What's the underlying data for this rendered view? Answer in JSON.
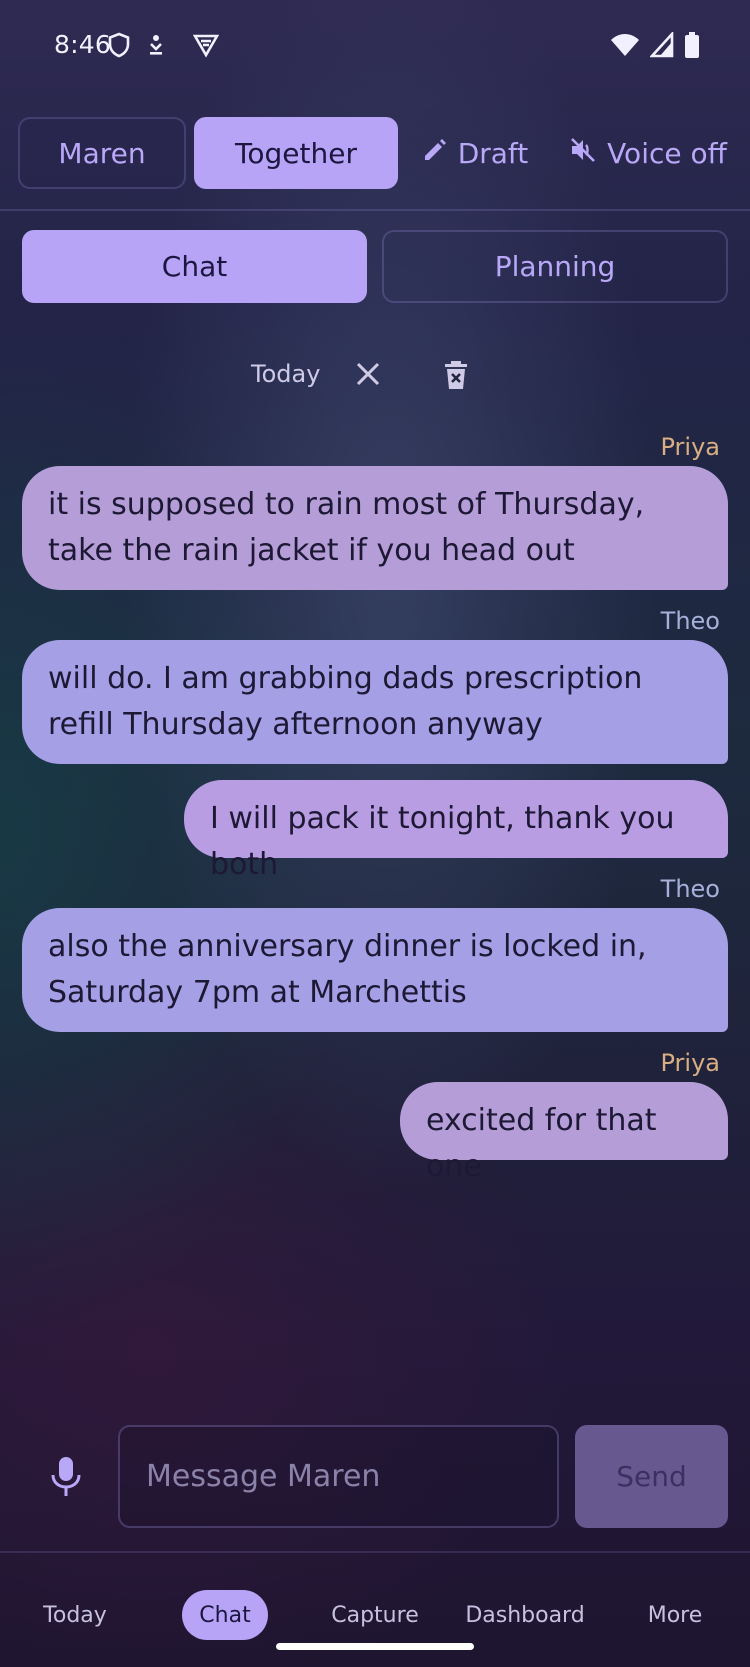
{
  "status_bar": {
    "time": "8:46"
  },
  "top_modes": {
    "maren": "Maren",
    "together": "Together",
    "draft": "Draft",
    "voice": "Voice off"
  },
  "tabs": {
    "chat": "Chat",
    "planning": "Planning"
  },
  "session": {
    "label": "Today"
  },
  "messages": [
    {
      "sender": "Priya",
      "text": "it is supposed to rain most of Thursday, take the rain jacket if you head out"
    },
    {
      "sender": "Theo",
      "text": "will do. I am grabbing dads prescription refill Thursday afternoon anyway"
    },
    {
      "sender": "",
      "text": "I will pack it tonight, thank you both"
    },
    {
      "sender": "Theo",
      "text": "also the anniversary dinner is locked in, Saturday 7pm at Marchettis"
    },
    {
      "sender": "Priya",
      "text": "excited for that one"
    }
  ],
  "composer": {
    "placeholder": "Message Maren",
    "value": "",
    "send_label": "Send"
  },
  "bottom_nav": {
    "items": [
      "Today",
      "Chat",
      "Capture",
      "Dashboard",
      "More"
    ],
    "active": "Chat"
  },
  "colors": {
    "accent": "#b7a4f6",
    "priya_name": "#d8ae82",
    "theo_name": "#a6b0d8",
    "bubble_priya": "#b59ed8",
    "bubble_theo": "#a59fe6",
    "bubble_self": "#b99de2"
  },
  "icons": [
    "shield-icon",
    "download-icon",
    "vpn-icon",
    "wifi-icon",
    "signal-icon",
    "battery-icon",
    "pencil-icon",
    "volume-off-icon",
    "close-icon",
    "trash-icon",
    "microphone-icon"
  ]
}
